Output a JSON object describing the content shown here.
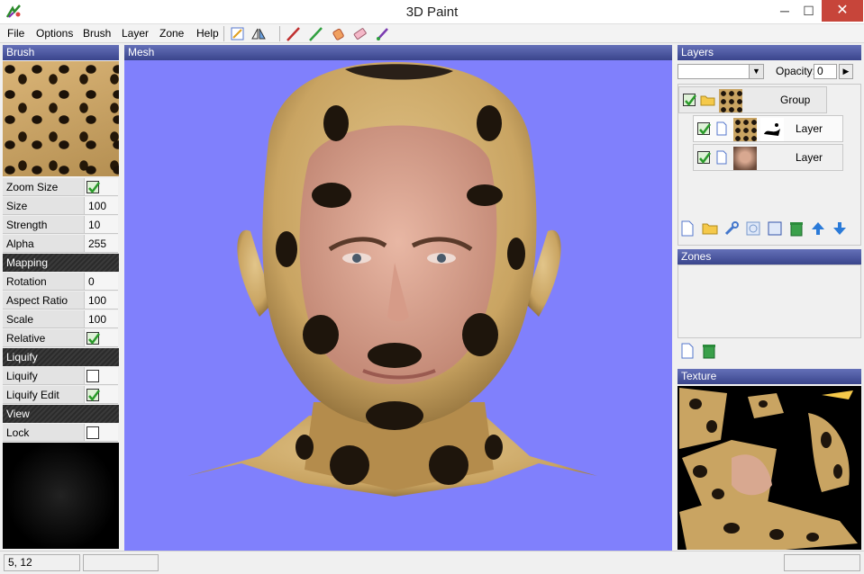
{
  "window": {
    "title": "3D Paint"
  },
  "menu": [
    "File",
    "Options",
    "Brush",
    "Layer",
    "Zone",
    "Help"
  ],
  "toolbar_icons": [
    "unwrap-tool-icon",
    "symmetry-tool-icon",
    "red-brush-icon",
    "green-brush-icon",
    "paint-bucket-icon",
    "eraser-icon",
    "smudge-brush-icon"
  ],
  "left": {
    "brush_header": "Brush",
    "props": [
      {
        "label": "Zoom Size",
        "checkbox": true,
        "checked": true
      },
      {
        "label": "Size",
        "value": "100"
      },
      {
        "label": "Strength",
        "value": "10"
      },
      {
        "label": "Alpha",
        "value": "255"
      }
    ],
    "mapping_header": "Mapping",
    "mapping": [
      {
        "label": "Rotation",
        "value": "0"
      },
      {
        "label": "Aspect Ratio",
        "value": "100"
      },
      {
        "label": "Scale",
        "value": "100"
      },
      {
        "label": "Relative",
        "checkbox": true,
        "checked": true
      }
    ],
    "liquify_header": "Liquify",
    "liquify": [
      {
        "label": "Liquify",
        "checkbox": true,
        "checked": false
      },
      {
        "label": "Liquify Edit",
        "checkbox": true,
        "checked": true
      }
    ],
    "view_header": "View",
    "view": [
      {
        "label": "Lock",
        "checkbox": true,
        "checked": false
      }
    ]
  },
  "mesh": {
    "header": "Mesh"
  },
  "right": {
    "layers_header": "Layers",
    "opacity_label": "Opacity:",
    "opacity_value": "0",
    "layers": [
      {
        "name": "Group",
        "type": "group"
      },
      {
        "name": "Layer",
        "type": "layer"
      },
      {
        "name": "Layer",
        "type": "layer"
      }
    ],
    "zones_header": "Zones",
    "texture_header": "Texture"
  },
  "status": {
    "coords": "5, 12"
  },
  "colors": {
    "accent": "#3a458c",
    "mesh_bg": "#8080fc",
    "close": "#c7453a"
  }
}
